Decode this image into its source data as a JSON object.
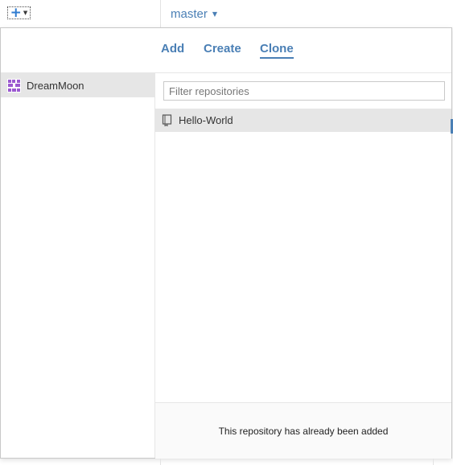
{
  "toolbar": {
    "add_menu_icon": "plus-icon",
    "branch_label": "master"
  },
  "popover": {
    "tabs": [
      {
        "label": "Add",
        "active": false
      },
      {
        "label": "Create",
        "active": false
      },
      {
        "label": "Clone",
        "active": true
      }
    ],
    "accounts": [
      {
        "name": "DreamMoon",
        "selected": true,
        "avatar_color": "#9b59d0"
      }
    ],
    "filter": {
      "placeholder": "Filter repositories",
      "value": ""
    },
    "repositories": [
      {
        "name": "Hello-World",
        "icon": "repo-book-icon",
        "selected": true
      }
    ],
    "status": "This repository has already been added"
  },
  "colors": {
    "accent": "#4a7fb5",
    "selection": "#e6e6e6",
    "plus": "#2f7bd0"
  }
}
